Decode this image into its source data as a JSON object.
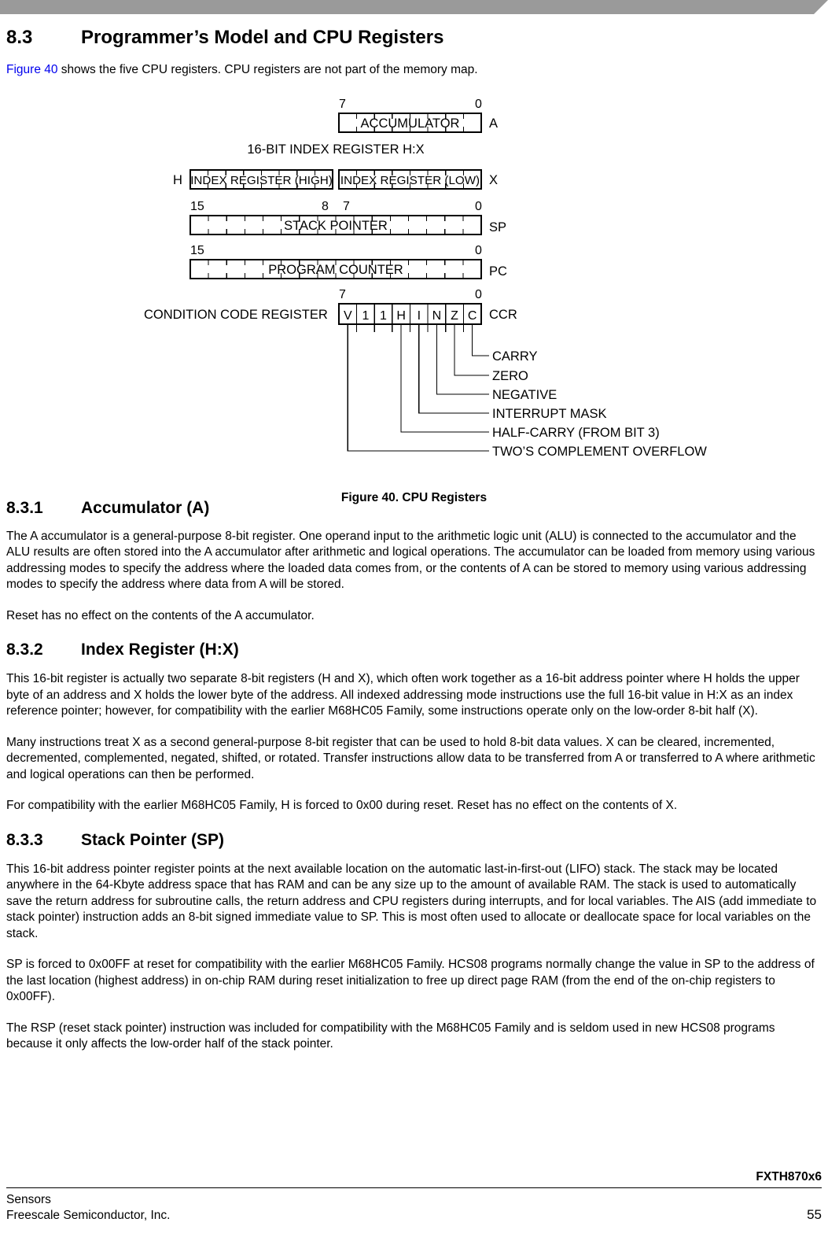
{
  "header": {
    "banner_color": "#9a9a9a"
  },
  "section": {
    "number": "8.3",
    "title": "Programmer’s Model and CPU Registers",
    "intro_link": "Figure 40",
    "intro_rest": " shows the five CPU registers. CPU registers are not part of the memory map.",
    "link_color": "#0000ee"
  },
  "figure": {
    "caption": "Figure 40. CPU Registers",
    "accumulator": {
      "bit_high": "7",
      "bit_low": "0",
      "label": "ACCUMULATOR",
      "name": "A"
    },
    "index": {
      "title": "16-BIT INDEX REGISTER H:X",
      "h_label": "H",
      "high_label": "INDEX REGISTER (HIGH)",
      "low_label": "INDEX REGISTER (LOW)",
      "name": "X"
    },
    "stack_pointer": {
      "bit_15": "15",
      "bit_8": "8",
      "bit_7": "7",
      "bit_0": "0",
      "label": "STACK POINTER",
      "name": "SP"
    },
    "program_counter": {
      "bit_15": "15",
      "bit_0": "0",
      "label": "PROGRAM COUNTER",
      "name": "PC"
    },
    "ccr": {
      "bit_high": "7",
      "bit_low": "0",
      "title": "CONDITION CODE REGISTER",
      "name": "CCR",
      "bits": [
        "V",
        "1",
        "1",
        "H",
        "I",
        "N",
        "Z",
        "C"
      ],
      "callouts": [
        "CARRY",
        "ZERO",
        "NEGATIVE",
        "INTERRUPT MASK",
        "HALF-CARRY (FROM BIT 3)",
        "TWO’S COMPLEMENT OVERFLOW"
      ]
    }
  },
  "subsections": [
    {
      "number": "8.3.1",
      "title": "Accumulator (A)",
      "paragraphs": [
        "The A accumulator is a general-purpose 8-bit register. One operand input to the arithmetic logic unit (ALU) is connected to the accumulator and the ALU results are often stored into the A accumulator after arithmetic and logical operations. The accumulator can be loaded from memory using various addressing modes to specify the address where the loaded data comes from, or the contents of A can be stored to memory using various addressing modes to specify the address where data from A will be stored.",
        "Reset has no effect on the contents of the A accumulator."
      ]
    },
    {
      "number": "8.3.2",
      "title": "Index Register (H:X)",
      "paragraphs": [
        "This 16-bit register is actually two separate 8-bit registers (H and X), which often work together as a 16-bit address pointer where H holds the upper byte of an address and X holds the lower byte of the address. All indexed addressing mode instructions use the full 16-bit value in H:X as an index reference pointer; however, for compatibility with the earlier M68HC05 Family, some instructions operate only on the low-order 8-bit half (X).",
        "Many instructions treat X as a second general-purpose 8-bit register that can be used to hold 8-bit data values. X can be cleared, incremented, decremented, complemented, negated, shifted, or rotated. Transfer instructions allow data to be transferred from A or transferred to A where arithmetic and logical operations can then be performed.",
        "For compatibility with the earlier M68HC05 Family, H is forced to 0x00 during reset. Reset has no effect on the contents of X."
      ]
    },
    {
      "number": "8.3.3",
      "title": "Stack Pointer (SP)",
      "paragraphs": [
        "This 16-bit address pointer register points at the next available location on the automatic last-in-first-out (LIFO) stack. The stack may be located anywhere in the 64-Kbyte address space that has RAM and can be any size up to the amount of available RAM. The stack is used to automatically save the return address for subroutine calls, the return address and CPU registers during interrupts, and for local variables. The AIS (add immediate to stack pointer) instruction adds an 8-bit signed immediate value to SP. This is most often used to allocate or deallocate space for local variables on the stack.",
        "SP is forced to 0x00FF at reset for compatibility with the earlier M68HC05 Family. HCS08 programs normally change the value in SP to the address of the last location (highest address) in on-chip RAM during reset initialization to free up direct page RAM (from the end of the on-chip registers to 0x00FF).",
        "The RSP (reset stack pointer) instruction was included for compatibility with the M68HC05 Family and is seldom used in new HCS08 programs because it only affects the low-order half of the stack pointer."
      ]
    }
  ],
  "footer": {
    "doc_id": "FXTH870x6",
    "sensors": "Sensors",
    "company": "Freescale Semiconductor, Inc.",
    "page_number": "55"
  }
}
